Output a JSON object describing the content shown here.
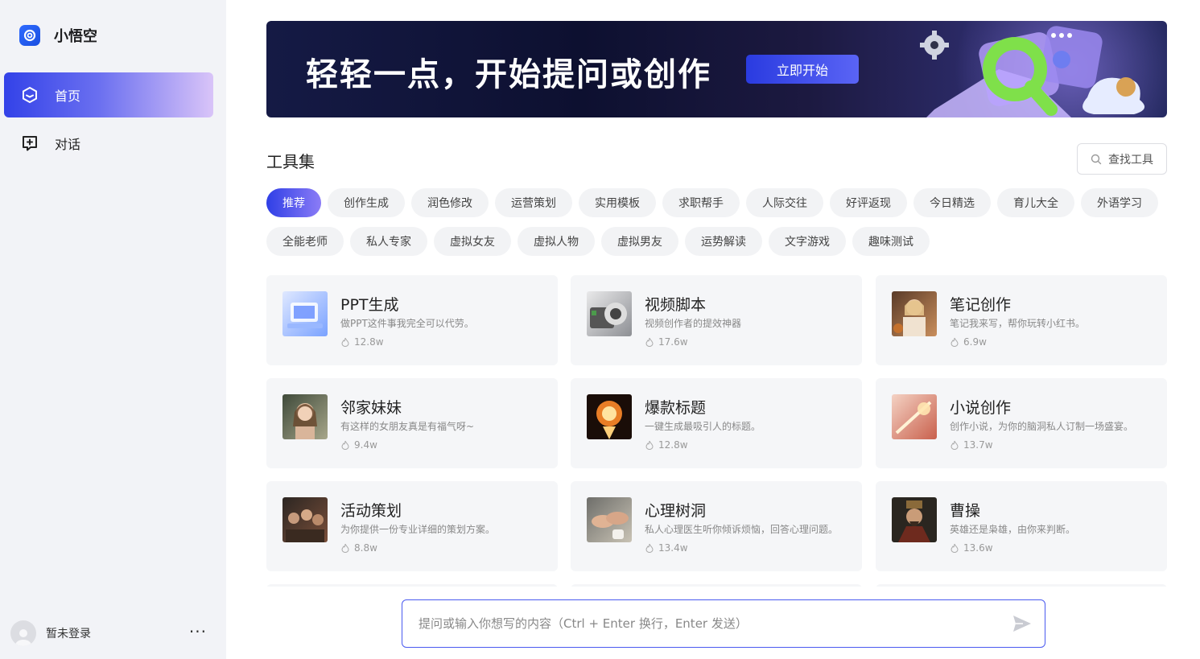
{
  "brand": {
    "name": "小悟空",
    "accent": "#2f6bff"
  },
  "nav": {
    "items": [
      {
        "label": "首页",
        "icon": "home-hexagon-icon",
        "active": true
      },
      {
        "label": "对话",
        "icon": "chat-plus-icon",
        "active": false
      }
    ]
  },
  "user": {
    "name": "暂未登录",
    "more": "···"
  },
  "banner": {
    "title": "轻轻一点，开始提问或创作",
    "button": "立即开始"
  },
  "tools": {
    "title": "工具集",
    "search_label": "查找工具",
    "categories": [
      "推荐",
      "创作生成",
      "润色修改",
      "运营策划",
      "实用模板",
      "求职帮手",
      "人际交往",
      "好评返现",
      "今日精选",
      "育儿大全",
      "外语学习",
      "全能老师",
      "私人专家",
      "虚拟女友",
      "虚拟人物",
      "虚拟男友",
      "运势解读",
      "文字游戏",
      "趣味测试"
    ],
    "active_category": "推荐"
  },
  "cards": [
    {
      "title": "PPT生成",
      "desc": "做PPT这件事我完全可以代劳。",
      "count": "12.8w"
    },
    {
      "title": "视频脚本",
      "desc": "视频创作者的提效神器",
      "count": "17.6w"
    },
    {
      "title": "笔记创作",
      "desc": "笔记我来写，帮你玩转小红书。",
      "count": "6.9w"
    },
    {
      "title": "邻家妹妹",
      "desc": "有这样的女朋友真是有福气呀~",
      "count": "9.4w"
    },
    {
      "title": "爆款标题",
      "desc": "一键生成最吸引人的标题。",
      "count": "12.8w"
    },
    {
      "title": "小说创作",
      "desc": "创作小说，为你的脑洞私人订制一场盛宴。",
      "count": "13.7w"
    },
    {
      "title": "活动策划",
      "desc": "为你提供一份专业详细的策划方案。",
      "count": "8.8w"
    },
    {
      "title": "心理树洞",
      "desc": "私人心理医生听你倾诉烦恼，回答心理问题。",
      "count": "13.4w"
    },
    {
      "title": "曹操",
      "desc": "英雄还是枭雄，由你来判断。",
      "count": "13.6w"
    }
  ],
  "composer": {
    "placeholder": "提问或输入你想写的内容（Ctrl + Enter 换行，Enter 发送）"
  }
}
